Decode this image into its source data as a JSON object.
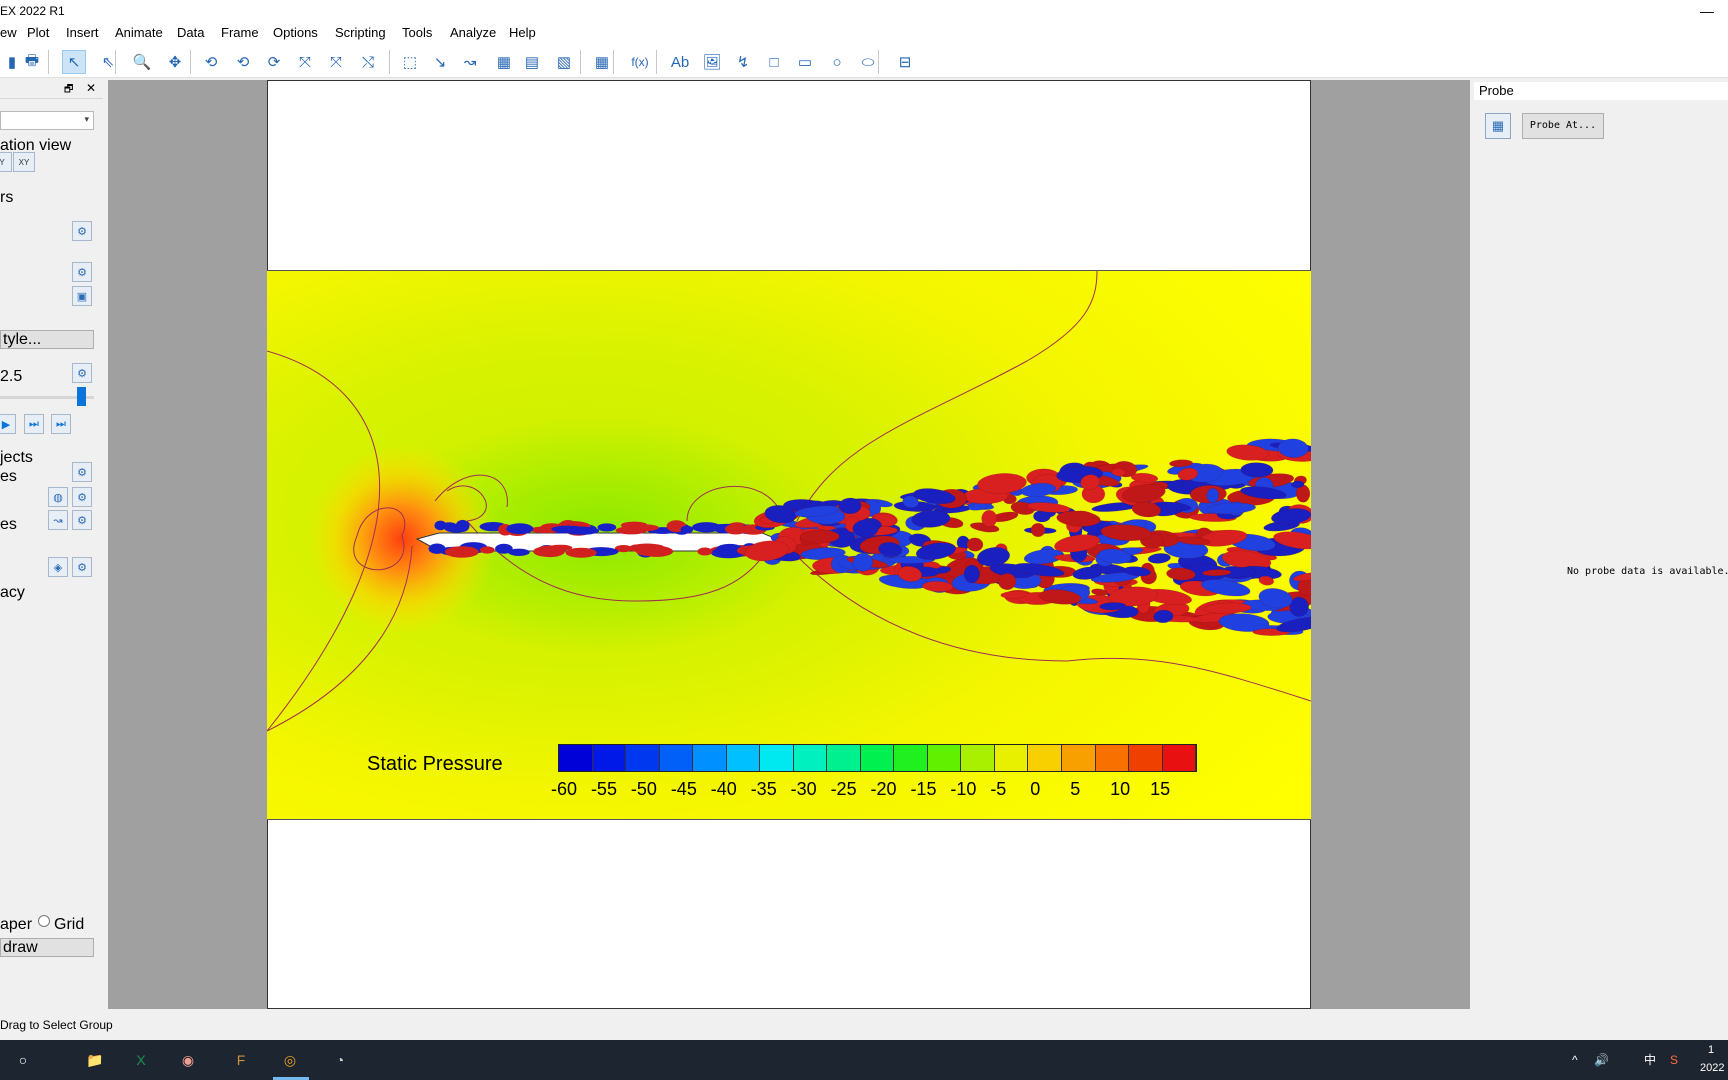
{
  "window": {
    "title": "EX 2022 R1",
    "minimize_glyph": "—"
  },
  "menu": [
    "ew",
    "Plot",
    "Insert",
    "Animate",
    "Data",
    "Frame",
    "Options",
    "Scripting",
    "Tools",
    "Analyze",
    "Help"
  ],
  "toolbar": {
    "icons": [
      "file-save-icon",
      "print-icon",
      "select-arrow-icon",
      "adjust-arrow-icon",
      "zoom-icon",
      "translate-icon",
      "rotate-x-icon",
      "rotate-y-icon",
      "rotate-z-icon",
      "roll-icon",
      "spherical-icon",
      "rotate-free-icon",
      "probe-point-icon",
      "streamtrace-icon",
      "slice-icon",
      "contour-icon",
      "geometry-icon",
      "layout-icon",
      "probe-grid-icon",
      "function-icon",
      "text-icon",
      "image-icon",
      "polyline-icon",
      "square-icon",
      "rectangle-icon",
      "circle-icon",
      "ellipse-icon",
      "frame-icon"
    ],
    "glyphs": [
      "▮",
      "🖶",
      "↖",
      "⇖",
      "🔍",
      "✥",
      "⟲",
      "⟲",
      "⟳",
      "⤧",
      "⤧",
      "⤭",
      "⬚",
      "↘",
      "↝",
      "▦",
      "▤",
      "▧",
      "▦",
      "f(x)",
      "Ab",
      "🖼",
      "↯",
      "□",
      "▭",
      "○",
      "⬭",
      "⊟"
    ]
  },
  "sidebar": {
    "labels": {
      "creation_view": "ation view",
      "layers": "rs",
      "style_button": "tyle...",
      "time_value": "2.5",
      "objects": "jects",
      "row_a": "es",
      "row_b": "es",
      "transparency": "acy",
      "paper": "aper",
      "grid": "Grid",
      "redraw": "draw"
    },
    "axis_buttons": [
      "Y",
      "XY"
    ]
  },
  "colormap": {
    "title": "Static Pressure",
    "levels": [
      -60,
      -55,
      -50,
      -45,
      -40,
      -35,
      -30,
      -25,
      -20,
      -15,
      -10,
      -5,
      0,
      5,
      10,
      15
    ],
    "colors": [
      "#0000d8",
      "#0018e8",
      "#0038f0",
      "#0060f8",
      "#0090ff",
      "#00c0ff",
      "#00e8f0",
      "#00f0c0",
      "#00f090",
      "#00f050",
      "#20f020",
      "#60f000",
      "#a8f000",
      "#e8f000",
      "#f8d000",
      "#f8a000",
      "#f87000",
      "#f04000",
      "#e81010"
    ]
  },
  "probe": {
    "title": "Probe",
    "button_label": "Probe At...",
    "message": "No probe data is available."
  },
  "status": {
    "text": "Drag to Select Group"
  },
  "taskbar": {
    "apps": [
      "start-icon",
      "file-explorer-icon",
      "excel-icon",
      "app-icon",
      "fluent-icon",
      "tecplot-icon",
      "recorder-icon"
    ],
    "glyphs": [
      "○",
      "📁",
      "X",
      "◉",
      "F",
      "◎",
      "◔"
    ],
    "tray_lang": "中",
    "clock_time": "1",
    "clock_date": "2022"
  }
}
